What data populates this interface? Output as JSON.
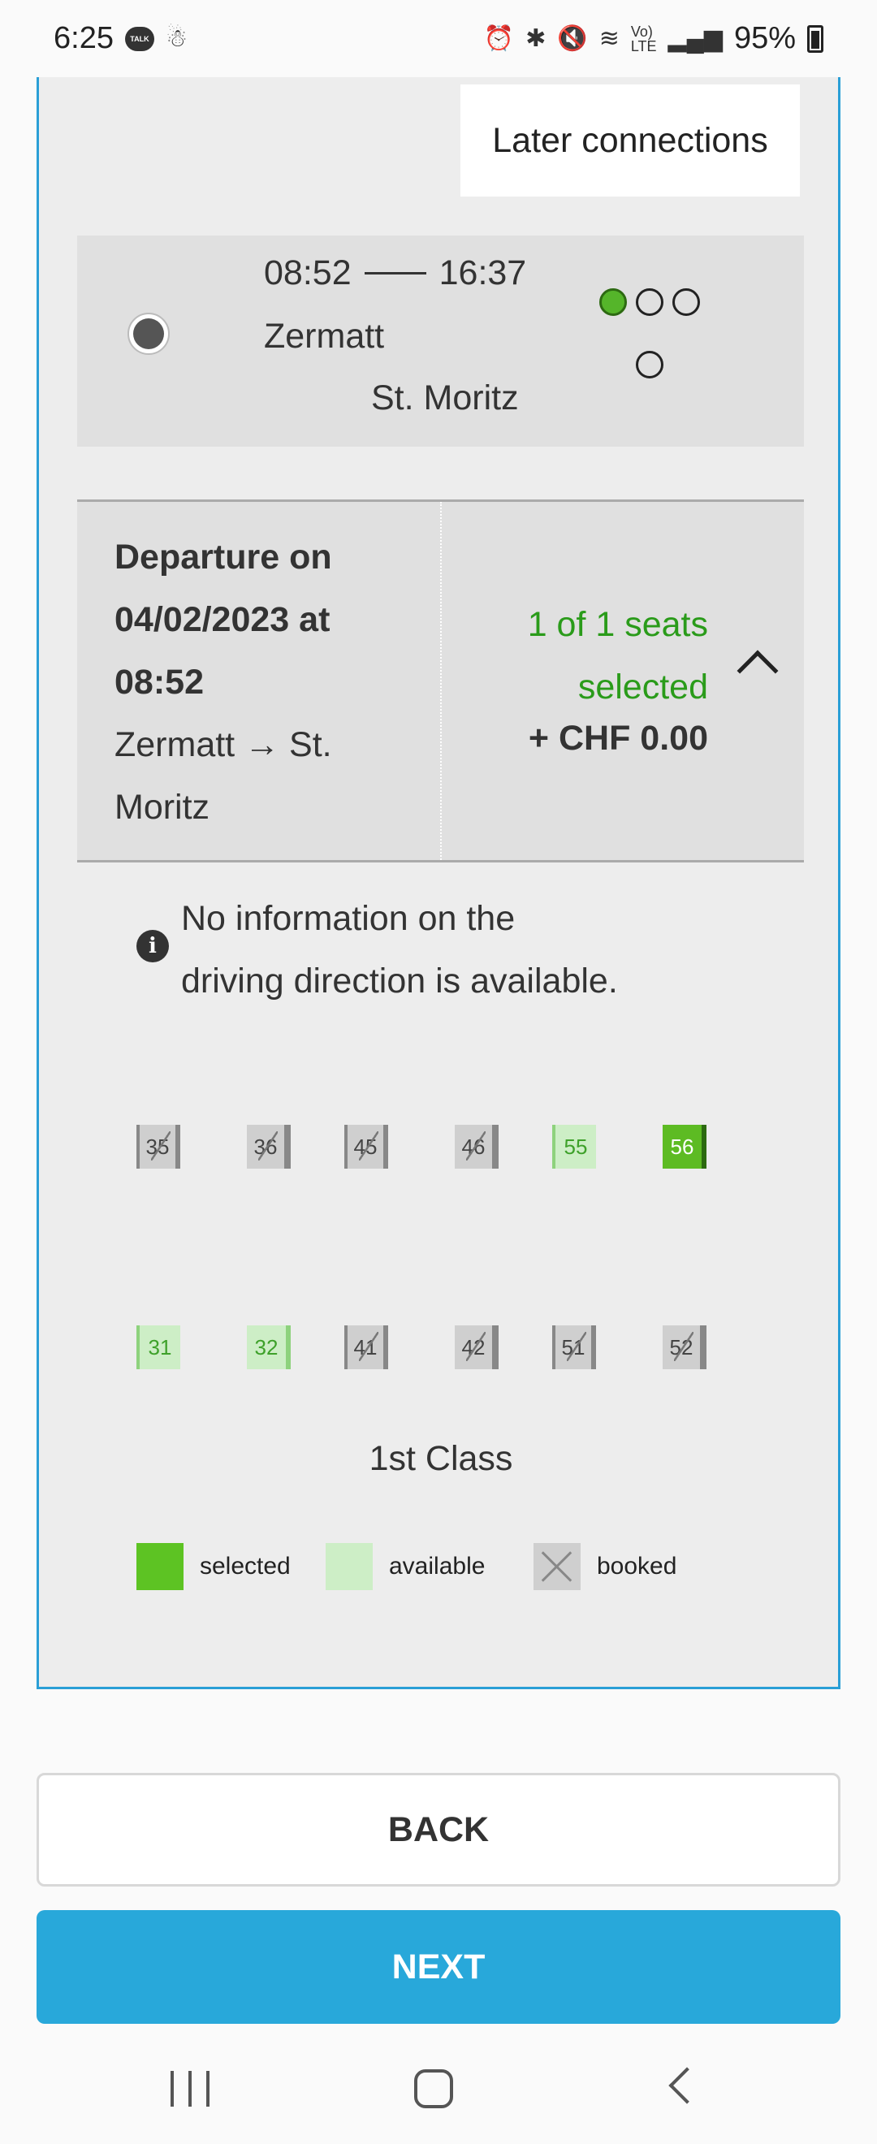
{
  "status_bar": {
    "time": "6:25",
    "talk_label": "TALK",
    "battery": "95%",
    "icons": [
      "alarm-icon",
      "bluetooth-icon",
      "mute-icon",
      "wifi-icon",
      "volte-icon",
      "signal-icon",
      "battery-icon"
    ]
  },
  "later_connections_label": "Later connections",
  "connection": {
    "departure_time": "08:52",
    "arrival_time": "16:37",
    "from": "Zermatt",
    "to": "St. Moritz",
    "occupancy_colors": {
      "filled": "#55b52a"
    }
  },
  "departure": {
    "line1": "Departure on",
    "line2": "04/02/2023 at",
    "line3": "08:52",
    "route_line1": "Zermatt → St.",
    "route_line2": "Moritz",
    "seats_line1": "1 of 1 seats",
    "seats_line2": "selected",
    "price": "+ CHF 0.00"
  },
  "info": {
    "line1": "No information on the",
    "line2": "driving direction is available."
  },
  "seats": {
    "row1": [
      "35",
      "36",
      "45",
      "46",
      "55",
      "56"
    ],
    "row2": [
      "31",
      "32",
      "41",
      "42",
      "51",
      "52"
    ],
    "row1_status": [
      "booked",
      "booked",
      "booked",
      "booked",
      "available",
      "selected"
    ],
    "row2_status": [
      "available",
      "available",
      "booked",
      "booked",
      "booked",
      "booked"
    ]
  },
  "class_label": "1st Class",
  "legend": {
    "selected": "selected",
    "available": "available",
    "booked": "booked"
  },
  "buttons": {
    "back": "BACK",
    "next": "NEXT"
  },
  "colors": {
    "accent": "#28a8da",
    "selected_green": "#5dbb23",
    "available_green": "#cdeec6",
    "seats_text_green": "#2a9b1a"
  }
}
